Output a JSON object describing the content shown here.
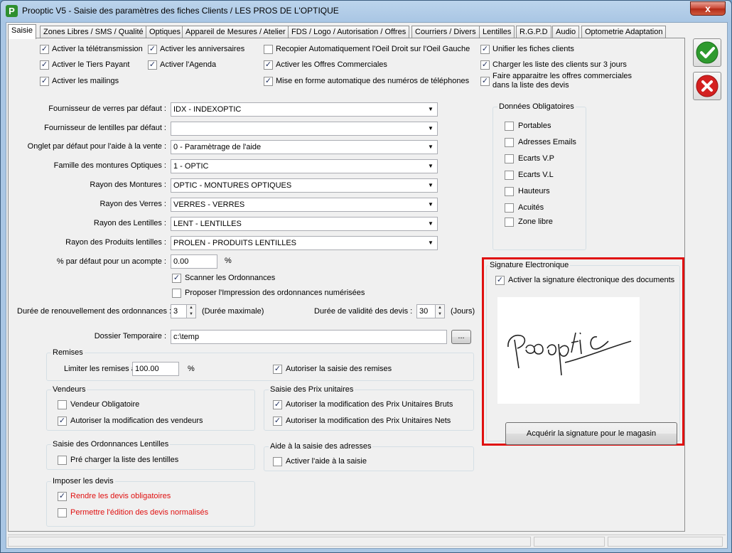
{
  "window": {
    "app_icon_letter": "P",
    "title": "Prooptic V5 - Saisie des paramètres des fiches Clients / LES PROS DE L'OPTIQUE",
    "close_label": "x"
  },
  "tabs": [
    "Saisie",
    "Zones Libres / SMS / Qualité",
    "Optiques",
    "Appareil de Mesures / Atelier",
    "FDS / Logo / Autorisation / Offres",
    "Courriers / Divers",
    "Lentilles",
    "R.G.P.D",
    "Audio",
    "Optometrie Adaptation"
  ],
  "top_checks": [
    {
      "label": "Activer la télétransmission",
      "checked": true
    },
    {
      "label": "Activer les anniversaires",
      "checked": true
    },
    {
      "label": "Recopier Automatiquement l'Oeil Droit sur l'Oeil Gauche",
      "checked": false
    },
    {
      "label": "Unifier les fiches clients",
      "checked": true
    },
    {
      "label": "Activer le Tiers Payant",
      "checked": true
    },
    {
      "label": "Activer l'Agenda",
      "checked": true
    },
    {
      "label": "Activer les Offres Commerciales",
      "checked": true
    },
    {
      "label": "Charger les liste des clients sur 3 jours",
      "checked": true
    },
    {
      "label": "Activer les mailings",
      "checked": true
    },
    {
      "label": "Mise en forme automatique des numéros de téléphones",
      "checked": true
    },
    {
      "label": "Faire apparaitre les offres commerciales",
      "label2": "dans la liste des devis",
      "checked": true
    }
  ],
  "combos": [
    {
      "label": "Fournisseur de verres par défaut :",
      "value": "IDX - INDEXOPTIC"
    },
    {
      "label": "Fournisseur de lentilles par défaut :",
      "value": ""
    },
    {
      "label": "Onglet par défaut pour l'aide à la vente :",
      "value": "0 - Paramètrage de l'aide"
    },
    {
      "label": "Famille des montures Optiques :",
      "value": "1 - OPTIC"
    },
    {
      "label": "Rayon des Montures :",
      "value": "OPTIC - MONTURES OPTIQUES"
    },
    {
      "label": "Rayon des Verres :",
      "value": "VERRES - VERRES"
    },
    {
      "label": "Rayon des Lentilles :",
      "value": "LENT - LENTILLES"
    },
    {
      "label": "Rayon des Produits lentilles :",
      "value": "PROLEN - PRODUITS LENTILLES"
    }
  ],
  "acompte": {
    "label": "% par défaut pour un acompte :",
    "value": "0.00",
    "unit": "%"
  },
  "ordonnances": [
    {
      "label": "Scanner les Ordonnances",
      "checked": true
    },
    {
      "label": "Proposer l'Impression des ordonnances numérisées",
      "checked": false
    }
  ],
  "renouvellement": {
    "label": "Durée de renouvellement des ordonnances :",
    "value": "3",
    "note": "(Durée maximale)"
  },
  "validite": {
    "label": "Durée de validité des devis :",
    "value": "30",
    "note": "(Jours)"
  },
  "dossier": {
    "label": "Dossier Temporaire :",
    "value": "c:\\temp",
    "browse_label": "..."
  },
  "remises": {
    "title": "Remises",
    "limit_label": "Limiter les remises à :",
    "limit_value": "100.00",
    "unit": "%",
    "autoriser": {
      "label": "Autoriser la saisie des remises",
      "checked": true
    }
  },
  "vendeurs": {
    "title": "Vendeurs",
    "items": [
      {
        "label": "Vendeur Obligatoire",
        "checked": false
      },
      {
        "label": "Autoriser la modification des vendeurs",
        "checked": true
      }
    ]
  },
  "prix": {
    "title": "Saisie des Prix unitaires",
    "items": [
      {
        "label": "Autoriser la modification des Prix Unitaires Bruts",
        "checked": true
      },
      {
        "label": "Autoriser la modification des Prix Unitaires Nets",
        "checked": true
      }
    ]
  },
  "ord_lentilles": {
    "title": "Saisie des Ordonnances Lentilles",
    "item": {
      "label": "Pré charger la liste des lentilles",
      "checked": false
    }
  },
  "adresses": {
    "title": "Aide à la saisie des adresses",
    "item": {
      "label": "Activer l'aide à la saisie",
      "checked": false
    }
  },
  "devis": {
    "title": "Imposer les devis",
    "items": [
      {
        "label": "Rendre les devis obligatoires",
        "checked": true
      },
      {
        "label": "Permettre l'édition des devis normalisés",
        "checked": false
      }
    ]
  },
  "donnees": {
    "title": "Données Obligatoires",
    "items": [
      {
        "label": "Portables",
        "checked": false
      },
      {
        "label": "Adresses Emails",
        "checked": false
      },
      {
        "label": "Ecarts V.P",
        "checked": false
      },
      {
        "label": "Ecarts V.L",
        "checked": false
      },
      {
        "label": "Hauteurs",
        "checked": false
      },
      {
        "label": "Acuités",
        "checked": false
      },
      {
        "label": "Zone libre",
        "checked": false
      }
    ]
  },
  "signature": {
    "title": "Signature Electronique",
    "activer": {
      "label": "Activer la signature électronique des documents",
      "checked": true
    },
    "acquire_label": "Acquérir la signature pour le magasin",
    "highlight_color": "#e01010"
  },
  "actions": {
    "ok_color": "#2e9a2e",
    "cancel_color": "#d42020"
  }
}
